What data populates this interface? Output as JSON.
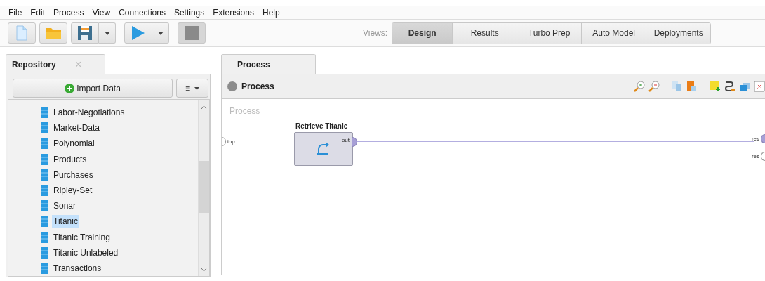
{
  "menu": [
    {
      "label": "File"
    },
    {
      "label": "Edit"
    },
    {
      "label": "Process"
    },
    {
      "label": "View"
    },
    {
      "label": "Connections"
    },
    {
      "label": "Settings"
    },
    {
      "label": "Extensions"
    },
    {
      "label": "Help"
    }
  ],
  "toolbar": [
    {
      "kind": "new",
      "disabled": false
    },
    {
      "kind": "open",
      "disabled": false
    },
    {
      "kind": "save",
      "disabled": false
    },
    {
      "kind": "dropdown",
      "disabled": false
    },
    {
      "kind": "run",
      "disabled": false
    },
    {
      "kind": "dropdown",
      "disabled": false
    },
    {
      "kind": "stop",
      "disabled": true
    }
  ],
  "views": {
    "label": "Views:",
    "tabs": [
      {
        "label": "Design",
        "selected": true
      },
      {
        "label": "Results",
        "selected": false
      },
      {
        "label": "Turbo Prep",
        "selected": false
      },
      {
        "label": "Auto Model",
        "selected": false
      },
      {
        "label": "Deployments",
        "selected": false
      }
    ]
  },
  "repository": {
    "tab": "Repository",
    "close": "×",
    "import_button": "Import Data",
    "menu_button": "≡",
    "items": [
      {
        "label": "Labor-Negotiations",
        "selected": false
      },
      {
        "label": "Market-Data",
        "selected": false
      },
      {
        "label": "Polynomial",
        "selected": false
      },
      {
        "label": "Products",
        "selected": false
      },
      {
        "label": "Purchases",
        "selected": false
      },
      {
        "label": "Ripley-Set",
        "selected": false
      },
      {
        "label": "Sonar",
        "selected": false
      },
      {
        "label": "Titanic",
        "selected": true
      },
      {
        "label": "Titanic Training",
        "selected": false
      },
      {
        "label": "Titanic Unlabeled",
        "selected": false
      },
      {
        "label": "Transactions",
        "selected": false
      }
    ]
  },
  "process": {
    "tab": "Process",
    "header": "Process",
    "canvas_label": "Process",
    "input_port": "inp",
    "operator": {
      "title": "Retrieve Titanic",
      "output_port": "out"
    },
    "outputs": [
      {
        "label": "res",
        "connected": true
      },
      {
        "label": "res",
        "connected": false
      }
    ]
  }
}
